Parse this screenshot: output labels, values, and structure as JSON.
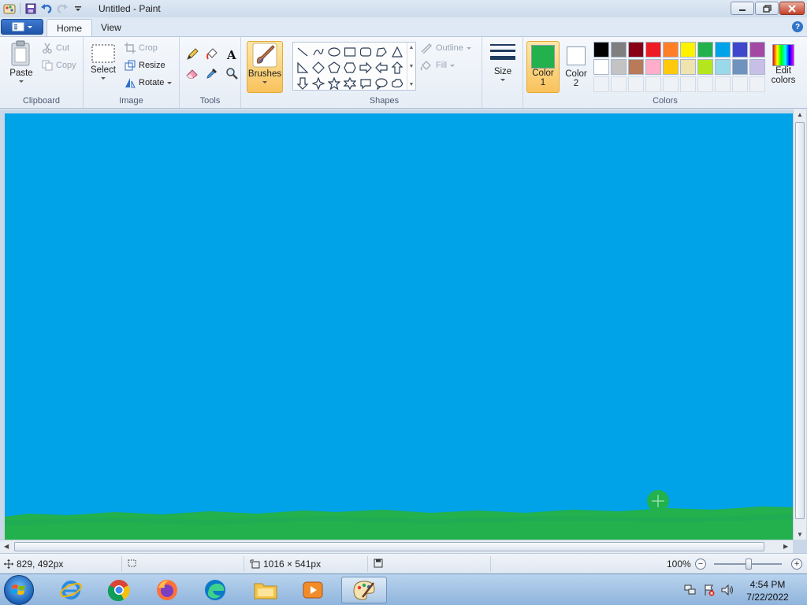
{
  "window": {
    "title": "Untitled - Paint"
  },
  "tabs": [
    {
      "label": "Home",
      "active": true
    },
    {
      "label": "View",
      "active": false
    }
  ],
  "ribbon": {
    "clipboard": {
      "group_label": "Clipboard",
      "paste_label": "Paste",
      "cut_label": "Cut",
      "copy_label": "Copy"
    },
    "image": {
      "group_label": "Image",
      "select_label": "Select",
      "crop_label": "Crop",
      "resize_label": "Resize",
      "rotate_label": "Rotate"
    },
    "tools": {
      "group_label": "Tools",
      "items": [
        "pencil-icon",
        "fill-bucket-icon",
        "text-icon",
        "eraser-icon",
        "color-picker-icon",
        "magnifier-icon"
      ]
    },
    "brushes": {
      "label": "Brushes"
    },
    "shapes": {
      "group_label": "Shapes",
      "outline_label": "Outline",
      "fill_label": "Fill"
    },
    "size": {
      "label": "Size"
    },
    "colors": {
      "group_label": "Colors",
      "color1_label": "Color\n1",
      "color1_line1": "Color",
      "color1_line2": "1",
      "color2_line1": "Color",
      "color2_line2": "2",
      "edit_line1": "Edit",
      "edit_line2": "colors",
      "color1_value": "#22b14c",
      "color2_value": "#ffffff",
      "palette_row1": [
        "#000000",
        "#7f7f7f",
        "#880015",
        "#ed1c24",
        "#ff7f27",
        "#fff200",
        "#22b14c",
        "#00a2e8",
        "#3f48cc",
        "#a349a4"
      ],
      "palette_row2": [
        "#ffffff",
        "#c3c3c3",
        "#b97a57",
        "#ffaec9",
        "#ffc90e",
        "#efe4b0",
        "#b5e61d",
        "#99d9ea",
        "#7092be",
        "#c8bfe7"
      ]
    }
  },
  "canvas": {
    "background_color": "#00a2e8",
    "grass_color": "#22b14c"
  },
  "statusbar": {
    "cursor_position": "829, 492px",
    "canvas_size": "1016 × 541px",
    "zoom_level": "100%"
  },
  "taskbar": {
    "time": "4:54 PM",
    "date": "7/22/2022"
  }
}
